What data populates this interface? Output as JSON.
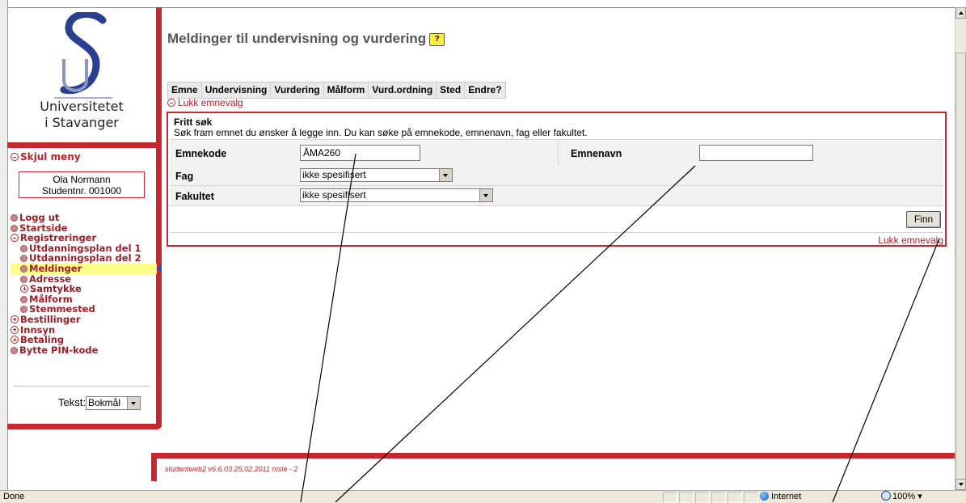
{
  "sidebar": {
    "university_line1": "Universitetet",
    "university_line2": "i Stavanger",
    "hide_menu": "Skjul meny",
    "user_name": "Ola Normann",
    "student_no": "Studentnr. 001000",
    "nav": [
      {
        "label": "Logg ut",
        "icon": "dot-icon"
      },
      {
        "label": "Startside",
        "icon": "dot-icon"
      },
      {
        "label": "Registreringer",
        "icon": "minus-icon"
      },
      {
        "label": "Utdanningsplan del 1",
        "icon": "dot-icon"
      },
      {
        "label": "Utdanningsplan del 2",
        "icon": "dot-icon"
      },
      {
        "label": "Meldinger",
        "icon": "dot-icon"
      },
      {
        "label": "Adresse",
        "icon": "dot-icon"
      },
      {
        "label": "Samtykke",
        "icon": "plus-icon"
      },
      {
        "label": "Målform",
        "icon": "dot-icon"
      },
      {
        "label": "Stemmested",
        "icon": "dot-icon"
      },
      {
        "label": "Bestillinger",
        "icon": "plus-icon"
      },
      {
        "label": "Innsyn",
        "icon": "plus-icon"
      },
      {
        "label": "Betaling",
        "icon": "plus-icon"
      },
      {
        "label": "Bytte PIN-kode",
        "icon": "dot-icon"
      }
    ],
    "text_label": "Tekst:",
    "text_value": "Bokmål"
  },
  "main": {
    "title": "Meldinger til undervisning og vurdering",
    "help_icon": "?",
    "tabs": [
      "Emne",
      "Undervisning",
      "Vurdering",
      "Målform",
      "Vurd.ordning",
      "Sted",
      "Endre?"
    ],
    "lukk_top": "Lukk emnevalg",
    "search": {
      "heading": "Fritt søk",
      "description": "Søk fram emnet du ønsker å legge inn. Du kan søke på emnekode, emnenavn, fag eller fakultet.",
      "emnekode_label": "Emnekode",
      "emnekode_value": "ÅMA260",
      "emnenavn_label": "Emnenavn",
      "emnenavn_value": "",
      "fag_label": "Fag",
      "fag_value": "ikke spesifisert",
      "fakultet_label": "Fakultet",
      "fakultet_value": "ikke spesifisert",
      "find_button": "Finn",
      "lukk_bottom": "Lukk emnevalg"
    }
  },
  "footer": {
    "version": "studentweb2 v6.6.03 25.02.2011 msle - 2"
  },
  "statusbar": {
    "status": "Done",
    "zone": "Internet",
    "zoom": "100%"
  },
  "colors": {
    "accent_red": "#c8272e",
    "highlight_yellow": "#ffff88"
  }
}
